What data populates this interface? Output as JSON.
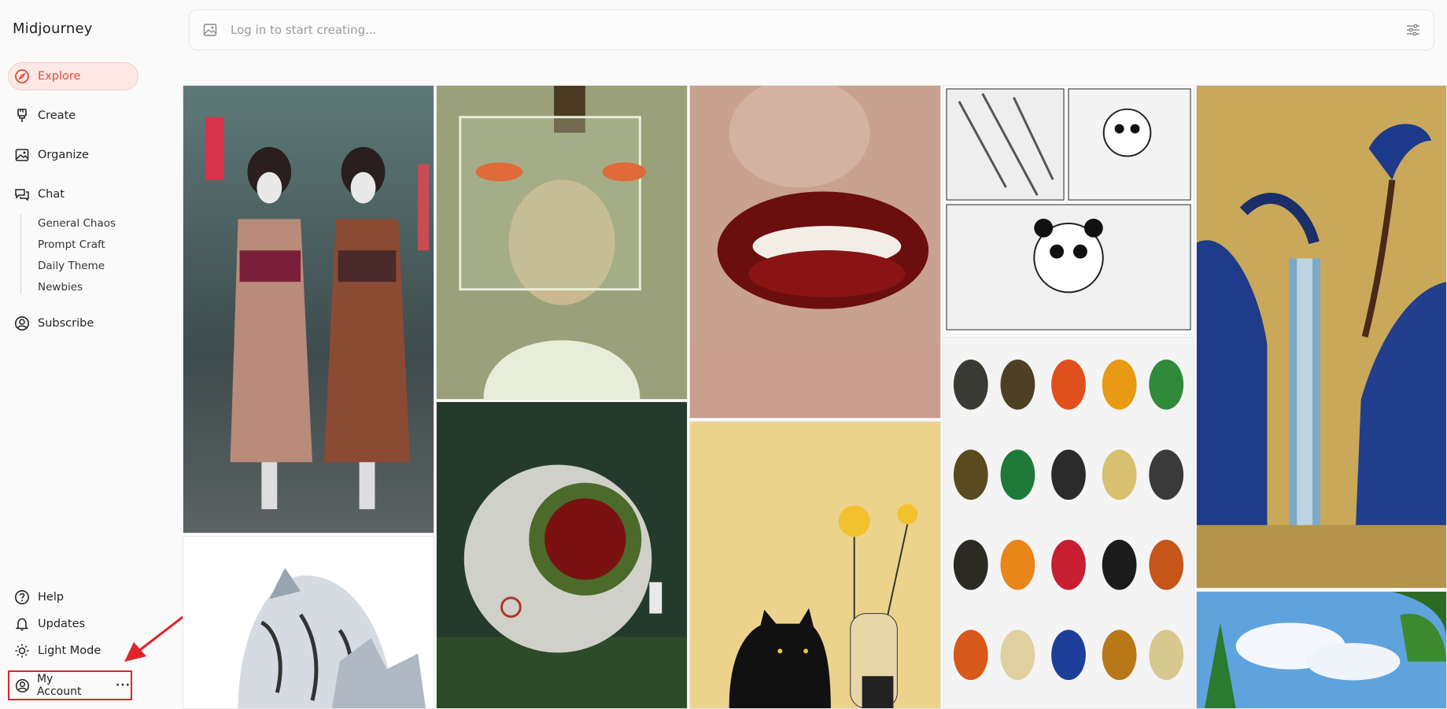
{
  "app": {
    "brand": "Midjourney"
  },
  "nav": {
    "explore": "Explore",
    "create": "Create",
    "organize": "Organize",
    "chat": "Chat",
    "chat_rooms": [
      "General Chaos",
      "Prompt Craft",
      "Daily Theme",
      "Newbies"
    ],
    "subscribe": "Subscribe",
    "help": "Help",
    "updates": "Updates",
    "light_mode": "Light Mode",
    "account": "My Account",
    "account_more": "···"
  },
  "search": {
    "placeholder": "Log in to start creating..."
  },
  "colors": {
    "accent": "#e04b3c",
    "highlight_box": "#e0242a"
  },
  "gallery": {
    "images": [
      "geisha-robots-image",
      "boy-fish-tank-image",
      "lips-fangs-image",
      "panda-astronaut-comic-image",
      "blue-gold-waterfall-image",
      "white-tiger-image",
      "moss-sphere-astronaut-image",
      "black-cat-flowers-image",
      "beetles-grid-image",
      "sky-trees-image"
    ]
  }
}
